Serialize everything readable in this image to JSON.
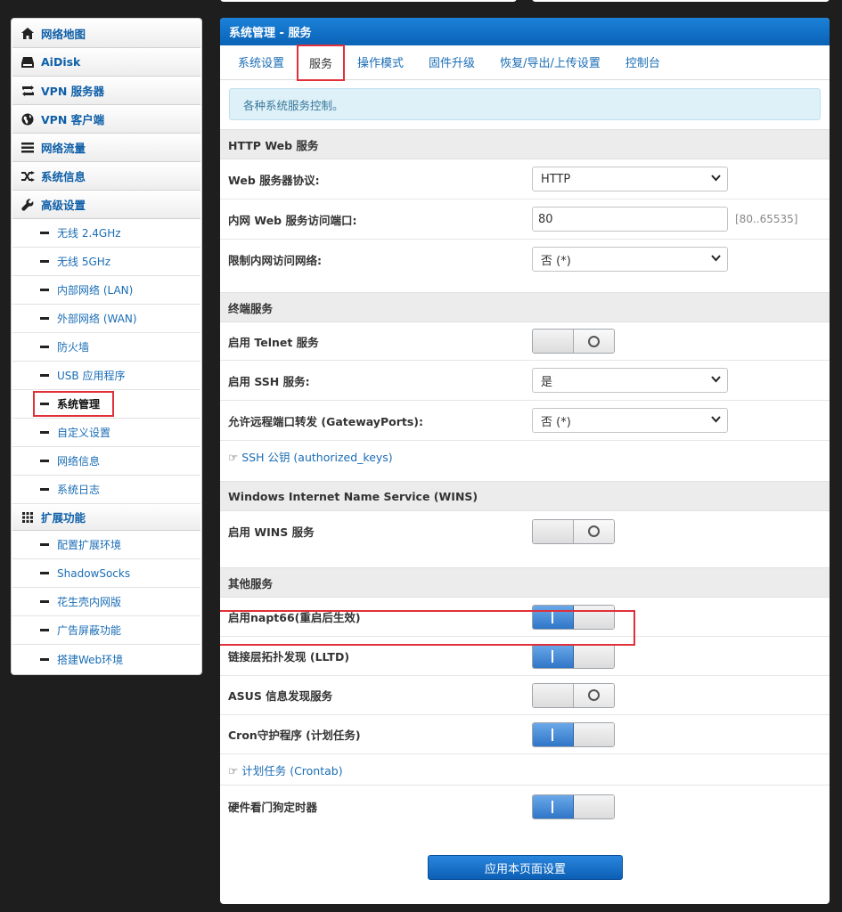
{
  "sidebar": {
    "items": [
      {
        "label": "网络地图",
        "icon": "home-icon"
      },
      {
        "label": "AiDisk",
        "icon": "disk-icon"
      },
      {
        "label": "VPN 服务器",
        "icon": "swap-icon"
      },
      {
        "label": "VPN 客户端",
        "icon": "globe-icon"
      },
      {
        "label": "网络流量",
        "icon": "traffic-icon"
      },
      {
        "label": "系统信息",
        "icon": "shuffle-icon"
      },
      {
        "label": "高级设置",
        "icon": "wrench-icon"
      }
    ],
    "advanced": [
      "无线 2.4GHz",
      "无线 5GHz",
      "内部网络 (LAN)",
      "外部网络 (WAN)",
      "防火墙",
      "USB 应用程序",
      "系统管理",
      "自定义设置",
      "网络信息",
      "系统日志"
    ],
    "ext_label": "扩展功能",
    "ext": [
      "配置扩展环境",
      "ShadowSocks",
      "花生壳内网版",
      "广告屏蔽功能",
      "搭建Web环境"
    ]
  },
  "panel": {
    "title": "系统管理 - 服务",
    "tabs": [
      "系统设置",
      "服务",
      "操作模式",
      "固件升级",
      "恢复/导出/上传设置",
      "控制台"
    ],
    "note": "各种系统服务控制。"
  },
  "http": {
    "head": "HTTP Web 服务",
    "protocol_label": "Web 服务器协议:",
    "protocol_value": "HTTP",
    "port_label": "内网 Web 服务访问端口:",
    "port_value": "80",
    "port_hint": "[80..65535]",
    "restrict_label": "限制内网访问网络:",
    "restrict_value": "否 (*)"
  },
  "terminal": {
    "head": "终端服务",
    "telnet_label": "启用 Telnet 服务",
    "ssh_label": "启用 SSH 服务:",
    "ssh_value": "是",
    "gateway_label": "允许远程端口转发 (GatewayPorts):",
    "gateway_value": "否 (*)",
    "keys_link": "SSH 公钥 (authorized_keys)"
  },
  "wins": {
    "head": "Windows Internet Name Service (WINS)",
    "enable_label": "启用 WINS 服务"
  },
  "other": {
    "head": "其他服务",
    "napt66_label": "启用napt66(重启后生效)",
    "lltd_label": "链接层拓扑发现 (LLTD)",
    "asus_label": "ASUS 信息发现服务",
    "cron_label": "Cron守护程序 (计划任务)",
    "crontab_link": "计划任务 (Crontab)",
    "watchdog_label": "硬件看门狗定时器"
  },
  "apply_label": "应用本页面设置"
}
